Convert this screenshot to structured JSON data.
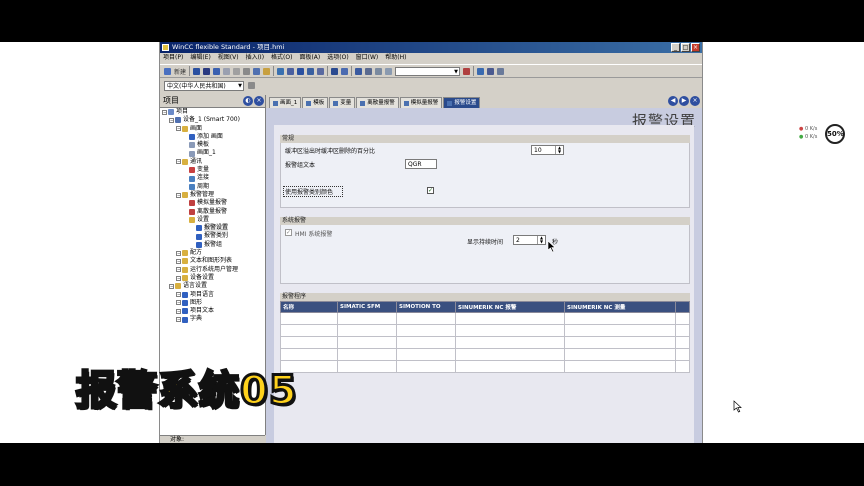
{
  "window": {
    "title": "WinCC flexible Standard - 项目.hmi"
  },
  "menu": [
    "项目(P)",
    "编辑(E)",
    "视图(V)",
    "插入(I)",
    "格式(O)",
    "面板(A)",
    "选项(O)",
    "窗口(W)",
    "帮助(H)"
  ],
  "toolbar": {
    "new_label": "新建"
  },
  "language": {
    "selected": "中文(中华人民共和国)"
  },
  "project_panel": {
    "title": "项目",
    "tree": [
      {
        "label": "项目",
        "level": 0,
        "icon": "#6a8ac8"
      },
      {
        "label": "设备_1 (Smart 700)",
        "level": 1,
        "icon": "#5070b0"
      },
      {
        "label": "画面",
        "level": 2,
        "icon": "#d8b040"
      },
      {
        "label": "添加 画面",
        "level": 3,
        "icon": "#3060c0"
      },
      {
        "label": "模板",
        "level": 3,
        "icon": "#8a9ab8"
      },
      {
        "label": "画面_1",
        "level": 3,
        "icon": "#8a9ab8"
      },
      {
        "label": "通讯",
        "level": 2,
        "icon": "#d8b040"
      },
      {
        "label": "变量",
        "level": 3,
        "icon": "#c84040"
      },
      {
        "label": "连接",
        "level": 3,
        "icon": "#4a80c0"
      },
      {
        "label": "周期",
        "level": 3,
        "icon": "#4a80c0"
      },
      {
        "label": "报警管理",
        "level": 2,
        "icon": "#d8b040"
      },
      {
        "label": "模拟量报警",
        "level": 3,
        "icon": "#c04040"
      },
      {
        "label": "离散量报警",
        "level": 3,
        "icon": "#c04040"
      },
      {
        "label": "设置",
        "level": 3,
        "icon": "#d8b040"
      },
      {
        "label": "报警设置",
        "level": 4,
        "icon": "#3060c0",
        "selected": true
      },
      {
        "label": "报警类别",
        "level": 4,
        "icon": "#3060c0"
      },
      {
        "label": "报警组",
        "level": 4,
        "icon": "#3060c0"
      },
      {
        "label": "配方",
        "level": 2,
        "icon": "#d8b040"
      },
      {
        "label": "文本和图形列表",
        "level": 2,
        "icon": "#d8b040"
      },
      {
        "label": "运行系统用户管理",
        "level": 2,
        "icon": "#d8b040"
      },
      {
        "label": "设备设置",
        "level": 2,
        "icon": "#d8b040"
      },
      {
        "label": "语言设置",
        "level": 1,
        "icon": "#d8b040"
      },
      {
        "label": "项目语言",
        "level": 2,
        "icon": "#3060c0"
      },
      {
        "label": "图形",
        "level": 2,
        "icon": "#3060c0"
      },
      {
        "label": "项目文本",
        "level": 2,
        "icon": "#3060c0"
      },
      {
        "label": "字典",
        "level": 2,
        "icon": "#3060c0"
      }
    ]
  },
  "bottom_panel": {
    "label": "对象:"
  },
  "tabs": [
    {
      "label": "画面_1"
    },
    {
      "label": "模板"
    },
    {
      "label": "变量"
    },
    {
      "label": "离散量报警"
    },
    {
      "label": "模拟量报警"
    },
    {
      "label": "报警设置",
      "active": true
    }
  ],
  "page_title": "报警设置",
  "general": {
    "heading": "常规",
    "buffer_label": "缓冲区溢出时缓冲区删除的百分比",
    "buffer_value": "10",
    "text_label": "报警组文本",
    "text_value": "QGR",
    "color_label": "使用报警类别颜色"
  },
  "system": {
    "heading": "系统报警",
    "hmi_label": "HMI 系统报警",
    "duration_label": "显示持续时间",
    "duration_value": "2",
    "duration_unit": "秒"
  },
  "procedures": {
    "heading": "报警程序",
    "columns": [
      "名称",
      "SIMATIC SFM",
      "SIMOTION TO",
      "SINUMERIK NC 报警",
      "SINUMERIK NC 测量"
    ]
  },
  "overlay": {
    "caption": "报警系统05"
  },
  "netmon": {
    "up": "0 K/s",
    "down": "0 K/s",
    "percent": "50%"
  }
}
